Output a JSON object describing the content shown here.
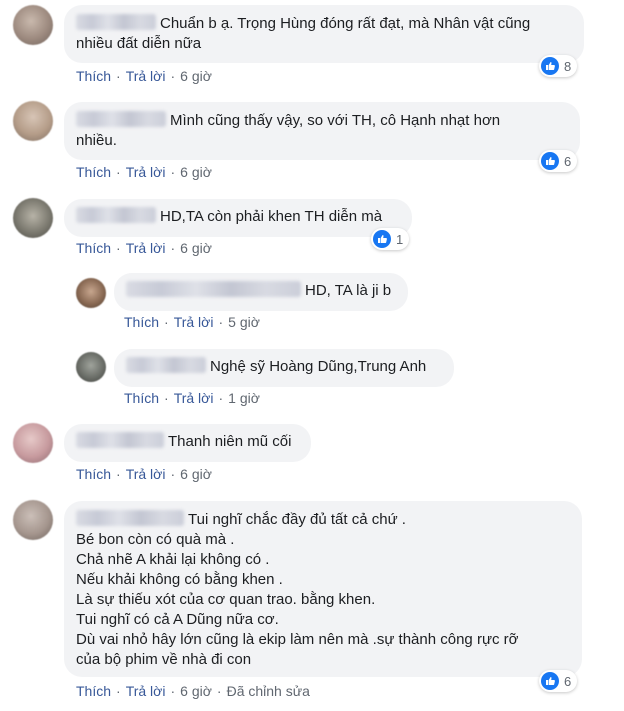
{
  "comments": [
    {
      "text": "Chuẩn b ạ. Trọng Hùng đóng rất đạt, mà Nhân vật cũng\nnhiều đất diễn nữa",
      "like_label": "Thích",
      "reply_label": "Trả lời",
      "time": "6 giờ",
      "reaction_count": "8"
    },
    {
      "text": "Mình cũng thấy vậy, so với TH, cô Hạnh nhạt hơn\nnhiều.",
      "like_label": "Thích",
      "reply_label": "Trả lời",
      "time": "6 giờ",
      "reaction_count": "6"
    },
    {
      "text": "HD,TA còn phải khen TH diễn mà",
      "like_label": "Thích",
      "reply_label": "Trả lời",
      "time": "6 giờ",
      "reaction_count": "1",
      "replies": [
        {
          "text": "HD, TA là ji b",
          "like_label": "Thích",
          "reply_label": "Trả lời",
          "time": "5 giờ"
        },
        {
          "text": "Nghệ sỹ Hoàng Dũng,Trung Anh",
          "like_label": "Thích",
          "reply_label": "Trả lời",
          "time": "1 giờ"
        }
      ]
    },
    {
      "text": "Thanh niên mũ cối",
      "like_label": "Thích",
      "reply_label": "Trả lời",
      "time": "6 giờ"
    },
    {
      "text": "Tui nghĩ chắc đầy đủ tất cả chứ .\nBé bon còn có quà mà .\nChả nhẽ A khải lại không có .\nNếu khải không có bằng khen .\nLà sự thiếu xót của cơ quan trao. bằng khen.\nTui nghĩ có cả A Dũng nữa cơ.\nDù vai nhỏ hây lớn cũng là ekip làm nên mà .sự thành công rực rỡ\ncủa bộ phim về nhà đi con",
      "like_label": "Thích",
      "reply_label": "Trả lời",
      "time": "6 giờ",
      "edited_label": "Đã chỉnh sửa",
      "reaction_count": "6"
    }
  ],
  "icons": {
    "reaction": "thumbs-up-icon"
  },
  "colors": {
    "bubble": "#f2f3f5",
    "link": "#385898",
    "meta": "#606770",
    "like_badge": "#1877f2"
  }
}
